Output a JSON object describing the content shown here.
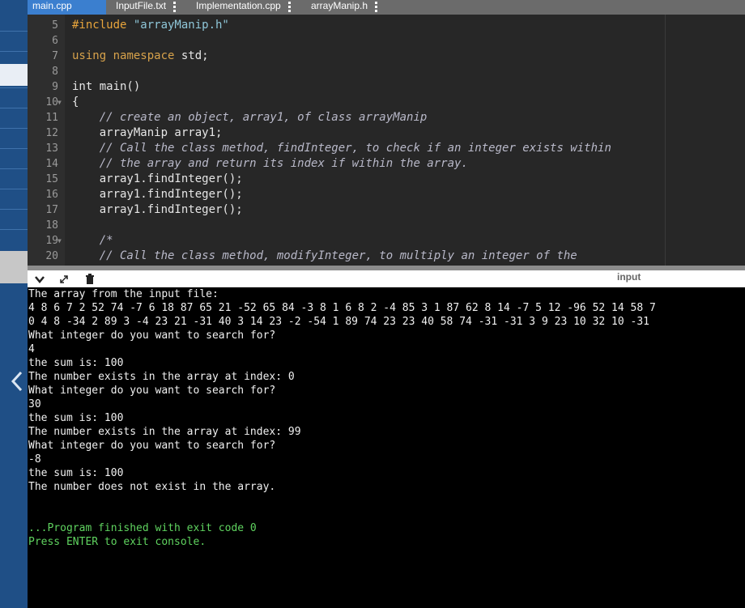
{
  "tabs": [
    {
      "label": "main.cpp",
      "active": true,
      "menu": false
    },
    {
      "label": "InputFile.txt",
      "active": false,
      "menu": true
    },
    {
      "label": "Implementation.cpp",
      "active": false,
      "menu": true
    },
    {
      "label": "arrayManip.h",
      "active": false,
      "menu": true
    }
  ],
  "editor": {
    "lines": [
      {
        "num": "5",
        "fold": "",
        "parts": [
          [
            "kw-inc",
            "#include "
          ],
          [
            "str",
            "\"arrayManip.h\""
          ]
        ]
      },
      {
        "num": "6",
        "fold": "",
        "parts": []
      },
      {
        "num": "7",
        "fold": "",
        "parts": [
          [
            "kw",
            "using"
          ],
          [
            "",
            " "
          ],
          [
            "kw",
            "namespace"
          ],
          [
            "",
            " std;"
          ]
        ]
      },
      {
        "num": "8",
        "fold": "",
        "parts": []
      },
      {
        "num": "9",
        "fold": "",
        "parts": [
          [
            "",
            "int main()"
          ]
        ]
      },
      {
        "num": "10",
        "fold": "▼",
        "parts": [
          [
            "",
            "{"
          ]
        ]
      },
      {
        "num": "11",
        "fold": "",
        "parts": [
          [
            "",
            "    "
          ],
          [
            "cmt",
            "// create an object, array1, of class arrayManip"
          ]
        ]
      },
      {
        "num": "12",
        "fold": "",
        "parts": [
          [
            "",
            "    arrayManip array1;"
          ]
        ]
      },
      {
        "num": "13",
        "fold": "",
        "parts": [
          [
            "",
            "    "
          ],
          [
            "cmt",
            "// Call the class method, findInteger, to check if an integer exists within"
          ]
        ]
      },
      {
        "num": "14",
        "fold": "",
        "parts": [
          [
            "",
            "    "
          ],
          [
            "cmt",
            "// the array and return its index if within the array."
          ]
        ]
      },
      {
        "num": "15",
        "fold": "",
        "parts": [
          [
            "",
            "    array1.findInteger();"
          ]
        ]
      },
      {
        "num": "16",
        "fold": "",
        "parts": [
          [
            "",
            "    array1.findInteger();"
          ]
        ]
      },
      {
        "num": "17",
        "fold": "",
        "parts": [
          [
            "",
            "    array1.findInteger();"
          ]
        ]
      },
      {
        "num": "18",
        "fold": "",
        "parts": []
      },
      {
        "num": "19",
        "fold": "▼",
        "parts": [
          [
            "",
            "    "
          ],
          [
            "cmt",
            "/*"
          ]
        ]
      },
      {
        "num": "20",
        "fold": "",
        "parts": [
          [
            "",
            "    "
          ],
          [
            "cmt",
            "// Call the class method, modifyInteger, to multiply an integer of the"
          ]
        ]
      }
    ]
  },
  "consolebar": {
    "label": "input"
  },
  "console": {
    "lines": [
      {
        "text": "The array from the input file:",
        "color": "white"
      },
      {
        "text": "4 8 6 7 2 52 74 -7 6 18 87 65 21 -52 65 84 -3 8 1 6 8 2 -4 85 3 1 87 62 8 14 -7 5 12 -96 52 14 58 7",
        "color": "white"
      },
      {
        "text": "0 4 8 -34 2 89 3 -4 23 21 -31 40 3 14 23 -2 -54 1 89 74 23 23 40 58 74 -31 -31 3 9 23 10 32 10 -31",
        "color": "white"
      },
      {
        "text": "What integer do you want to search for?",
        "color": "white"
      },
      {
        "text": "4",
        "color": "white"
      },
      {
        "text": "the sum is: 100",
        "color": "white"
      },
      {
        "text": "The number exists in the array at index: 0",
        "color": "white"
      },
      {
        "text": "What integer do you want to search for?",
        "color": "white"
      },
      {
        "text": "30",
        "color": "white"
      },
      {
        "text": "the sum is: 100",
        "color": "white"
      },
      {
        "text": "The number exists in the array at index: 99",
        "color": "white"
      },
      {
        "text": "What integer do you want to search for?",
        "color": "white"
      },
      {
        "text": "-8",
        "color": "white"
      },
      {
        "text": "the sum is: 100",
        "color": "white"
      },
      {
        "text": "The number does not exist in the array.",
        "color": "white"
      },
      {
        "text": "",
        "color": "white"
      },
      {
        "text": "",
        "color": "white"
      },
      {
        "text": "...Program finished with exit code 0",
        "color": "green"
      },
      {
        "text": "Press ENTER to exit console.",
        "color": "green"
      }
    ]
  },
  "colors": {
    "tab_active": "#3b7fcf",
    "console_green": "#5fd35f",
    "left_strip": "#1f4f86"
  }
}
